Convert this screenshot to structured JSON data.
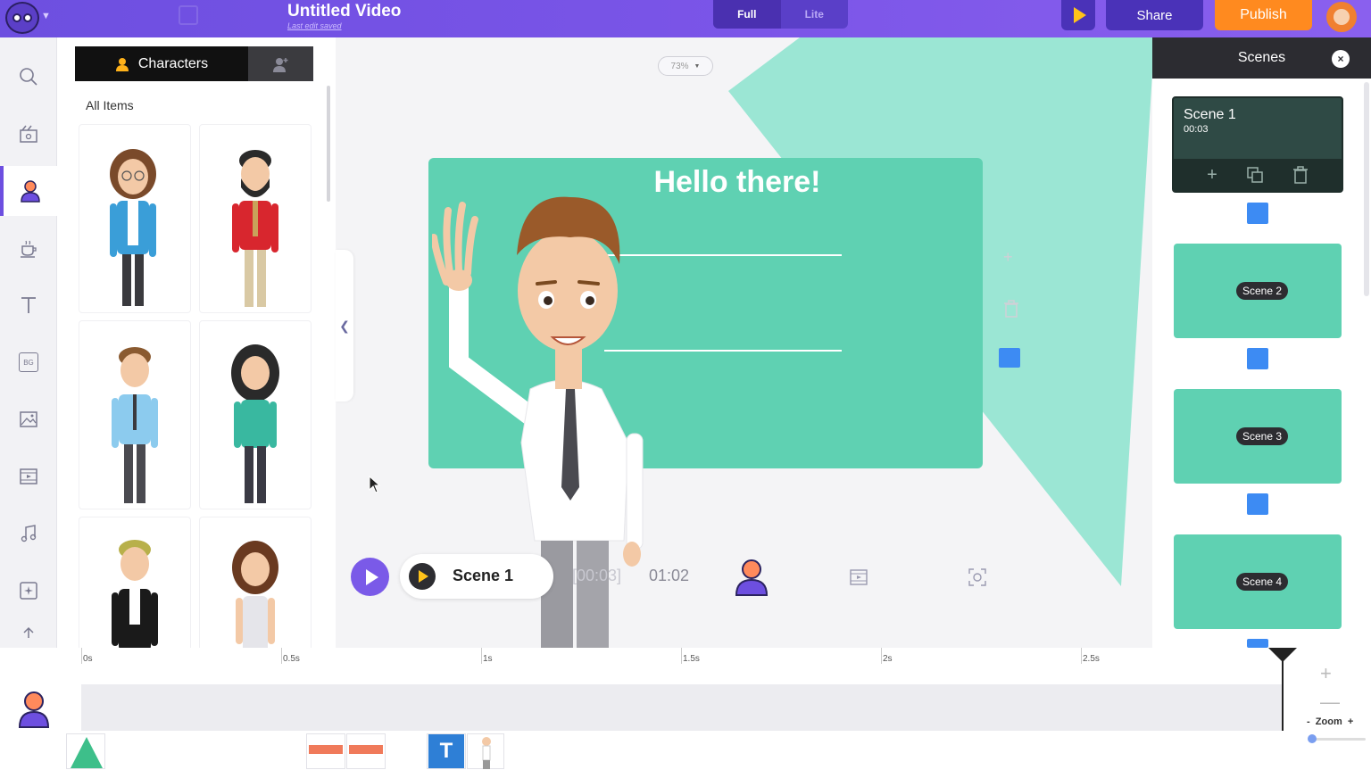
{
  "header": {
    "title": "Untitled Video",
    "subtitle": "Last edit saved",
    "mode_full": "Full",
    "mode_lite": "Lite",
    "share_label": "Share",
    "publish_label": "Publish"
  },
  "rail": {
    "items": [
      "search-icon",
      "scene-icon",
      "character-icon",
      "props-icon",
      "text-icon",
      "bg-icon",
      "image-icon",
      "video-icon",
      "music-icon",
      "effects-icon",
      "upload-icon"
    ],
    "bg_label": "BG"
  },
  "library": {
    "tab_characters": "Characters",
    "all_items": "All Items"
  },
  "canvas": {
    "zoom": "73%",
    "headline": "Hello there!",
    "player_scene": "Scene 1",
    "time_current": "[00:03]",
    "time_total": "01:02"
  },
  "scenes": {
    "title": "Scenes",
    "items": [
      {
        "name": "Scene 1",
        "duration": "00:03"
      },
      {
        "name": "Scene 2"
      },
      {
        "name": "Scene 3"
      },
      {
        "name": "Scene 4"
      }
    ]
  },
  "timeline": {
    "ticks": [
      "0s",
      "0.5s",
      "1s",
      "1.5s",
      "2s",
      "2.5s"
    ],
    "zoom_label": "Zoom",
    "zoom_minus": "-",
    "zoom_plus": "+"
  },
  "colors": {
    "brand": "#6d4fe0",
    "publish": "#ff8a1f",
    "teal": "#5fd1b2",
    "accent_blue": "#3d8bf3"
  }
}
